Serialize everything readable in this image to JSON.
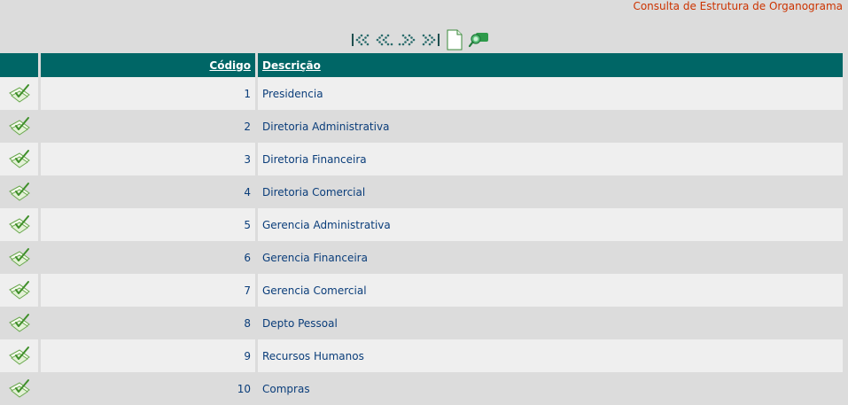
{
  "page": {
    "title": "Consulta de Estrutura de Organograma"
  },
  "toolbar": {
    "buttons": [
      {
        "name": "first-page-button",
        "icon": "first-page-icon"
      },
      {
        "name": "previous-page-button",
        "icon": "previous-page-icon"
      },
      {
        "name": "next-page-button",
        "icon": "next-page-icon"
      },
      {
        "name": "last-page-button",
        "icon": "last-page-icon"
      },
      {
        "name": "new-record-button",
        "icon": "new-document-icon"
      },
      {
        "name": "search-button",
        "icon": "search-icon"
      }
    ]
  },
  "colors": {
    "header_bg": "#006666",
    "header_text": "#ffffff",
    "title_text": "#cc3300",
    "row_odd": "#efefef",
    "row_even": "#dcdcdc",
    "cell_text": "#0a3d7a"
  },
  "table": {
    "columns": {
      "code": "Código",
      "description": "Descrição"
    },
    "rows": [
      {
        "code": "1",
        "description": "Presidencia"
      },
      {
        "code": "2",
        "description": "Diretoria Administrativa"
      },
      {
        "code": "3",
        "description": "Diretoria Financeira"
      },
      {
        "code": "4",
        "description": "Diretoria Comercial"
      },
      {
        "code": "5",
        "description": "Gerencia Administrativa"
      },
      {
        "code": "6",
        "description": "Gerencia Financeira"
      },
      {
        "code": "7",
        "description": "Gerencia Comercial"
      },
      {
        "code": "8",
        "description": "Depto Pessoal"
      },
      {
        "code": "9",
        "description": "Recursos Humanos"
      },
      {
        "code": "10",
        "description": "Compras"
      }
    ]
  }
}
